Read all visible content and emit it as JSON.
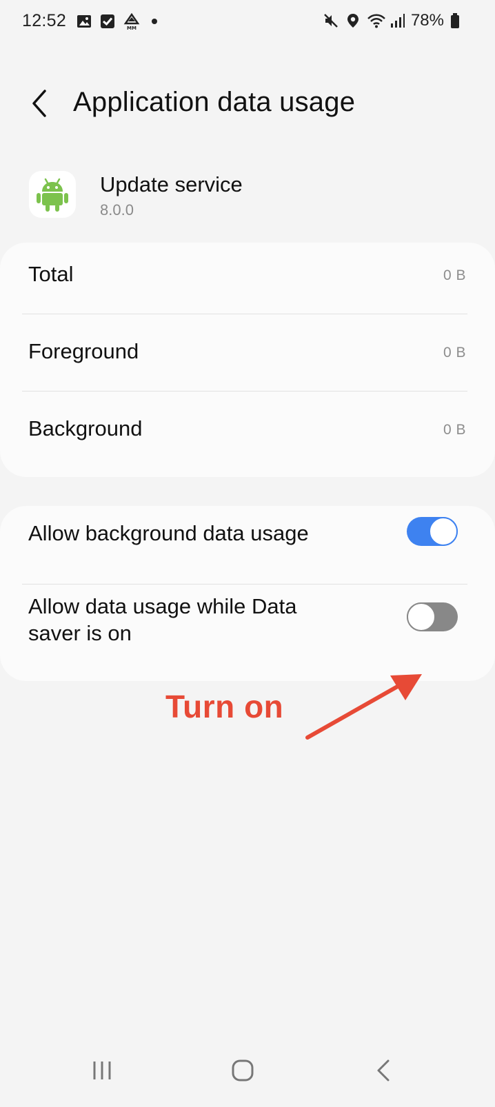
{
  "status_bar": {
    "time": "12:52",
    "battery": "78%",
    "left_icons": [
      "gallery-icon",
      "checkbox-icon",
      "app-notification-icon",
      "dot-icon"
    ],
    "right_icons": [
      "mute-icon",
      "location-icon",
      "wifi-icon",
      "signal-icon",
      "battery-icon"
    ]
  },
  "header": {
    "title": "Application data usage",
    "back_icon": "chevron-left-icon"
  },
  "app": {
    "name": "Update service",
    "version": "8.0.0",
    "icon": "android-icon",
    "icon_color": "#7cc24d"
  },
  "usage": {
    "rows": [
      {
        "label": "Total",
        "value": "0 B"
      },
      {
        "label": "Foreground",
        "value": "0 B"
      },
      {
        "label": "Background",
        "value": "0 B"
      }
    ]
  },
  "settings": {
    "allow_background": {
      "label": "Allow background data usage",
      "enabled": true
    },
    "allow_data_saver": {
      "label_line1": "Allow data usage while Data",
      "label_line2": "saver is on",
      "enabled": false
    }
  },
  "annotation": {
    "text": "Turn on",
    "color": "#e74a36"
  },
  "colors": {
    "accent": "#3e82f0",
    "toggle_off": "#888888",
    "background": "#f4f4f4",
    "card": "#fbfbfb"
  },
  "nav_bar": {
    "icons": [
      "recent-apps-icon",
      "home-icon",
      "back-icon"
    ]
  }
}
